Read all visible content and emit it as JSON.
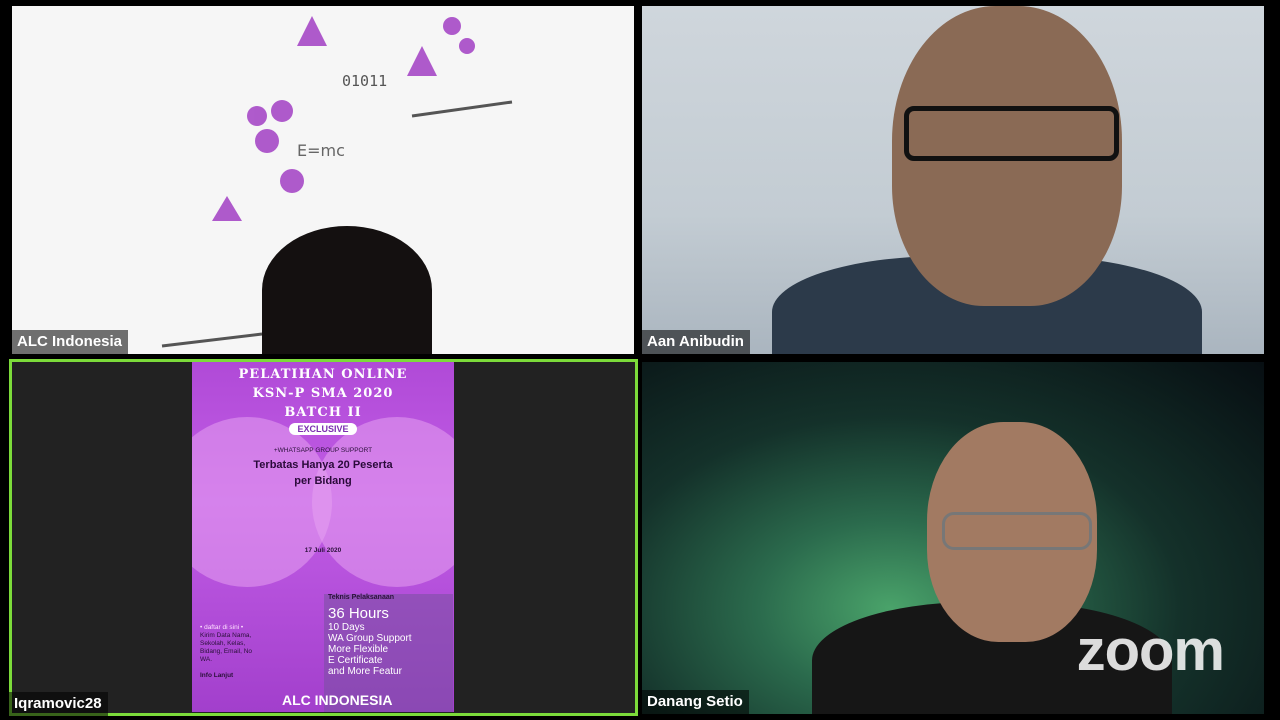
{
  "participants": [
    {
      "name": "ALC Indonesia",
      "active": false
    },
    {
      "name": "Aan Anibudin",
      "active": false
    },
    {
      "name": "Iqramovic28",
      "active": true
    },
    {
      "name": "Danang Setio",
      "active": false
    }
  ],
  "poster": {
    "title_line1": "PELATIHAN ONLINE",
    "title_line2": "KSN-P SMA 2020",
    "title_line3": "BATCH II",
    "exclusive": "EXCLUSIVE",
    "support": "+WHATSAPP GROUP SUPPORT",
    "headline1": "Terbatas Hanya 20 Peserta",
    "headline2": "per Bidang",
    "date": "17 Juli 2020",
    "teknis": "Teknis Pelaksanaan",
    "hours": "36 Hours",
    "days": "10 Days",
    "wa": "WA Group Support",
    "flexible": "More Flexible",
    "certificate": "E Certificate",
    "more": "and More Featur",
    "daftar": "• daftar di sini •",
    "kirim": "Kirim Data Nama, Sekolah, Kelas, Bidang, Email, No WA.",
    "info": "Info Lanjut",
    "brand": "ALC INDONESIA"
  },
  "watermark": "zoom",
  "colors": {
    "active_border": "#7cdb3a",
    "poster_bg": "#b04ad7"
  }
}
